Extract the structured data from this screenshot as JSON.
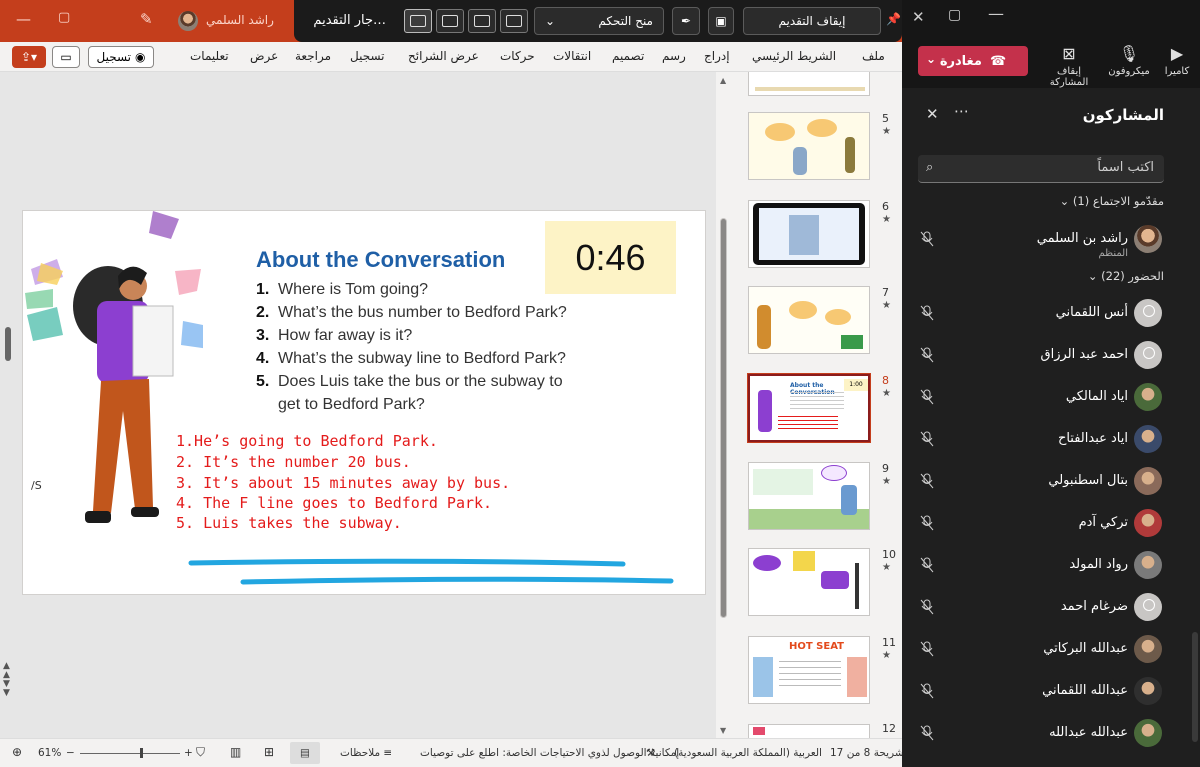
{
  "ppt": {
    "user_name": "راشد السلمي",
    "presenter": {
      "title": "…جار التقديم",
      "give_control": "منح التحكم",
      "stop_presenting": "إيقاف التقديم"
    },
    "ribbon_tabs": [
      "ملف",
      "الشريط الرئيسي",
      "إدراج",
      "رسم",
      "تصميم",
      "انتقالات",
      "حركات",
      "عرض الشرائح",
      "تسجيل",
      "مراجعة",
      "عرض",
      "تعليمات"
    ],
    "record_label": "تسجيل",
    "slide": {
      "title": "About the Conversation",
      "timer": "0:46",
      "questions": [
        {
          "n": "1.",
          "t": "Where is Tom going?"
        },
        {
          "n": "2.",
          "t": "What’s the bus number to Bedford Park?"
        },
        {
          "n": "3.",
          "t": "How far away is it?"
        },
        {
          "n": "4.",
          "t": "What’s the subway line to Bedford Park?"
        },
        {
          "n": "5.",
          "t": "Does Luis take the bus or the subway to"
        },
        {
          "n": "",
          "t": "get to Bedford Park?"
        }
      ],
      "answers": [
        "1.He’s going to Bedford Park.",
        "2. It’s the number 20 bus.",
        "3. It’s about 15 minutes away by bus.",
        "4. The F line goes to Bedford Park.",
        "5. Luis takes the subway."
      ]
    },
    "thumbnails": [
      {
        "num": "5"
      },
      {
        "num": "6"
      },
      {
        "num": "7"
      },
      {
        "num": "8",
        "timer": "1:00",
        "selected": true
      },
      {
        "num": "9"
      },
      {
        "num": "10"
      },
      {
        "num": "11",
        "text": "HOT SEAT"
      },
      {
        "num": "12"
      }
    ],
    "status": {
      "slide_pos": "شريحة 8 من 17",
      "language": "العربية (المملكة العربية السعودية)",
      "accessibility": "إمكانية الوصول لذوي الاحتياجات الخاصة: اطلع على توصيات",
      "notes": "ملاحظات",
      "zoom": "61%",
      "zoom_fraction": 0.6
    }
  },
  "teams": {
    "controls": {
      "camera": "كاميرا",
      "mic": "ميكروفون",
      "stop_share": "إيقاف المشاركة",
      "leave": "مغادرة"
    },
    "panel_title": "المشاركون",
    "search_placeholder": "اكتب اسماً",
    "organizers_header": "مقدّمو الاجتماع (1)",
    "organizer": {
      "name": "راشد بن السلمي",
      "role": "المنظم"
    },
    "attendees_header": "الحضور (22)",
    "attendees": [
      {
        "name": "أنس اللقماني",
        "avatar": "generic"
      },
      {
        "name": "احمد عبد الرزاق",
        "avatar": "generic"
      },
      {
        "name": "اياد المالكي",
        "avatar": "photo"
      },
      {
        "name": "اياد عبدالفتاح",
        "avatar": "photo"
      },
      {
        "name": "بتال اسطنبولي",
        "avatar": "photo"
      },
      {
        "name": "تركي آدم",
        "avatar": "photo"
      },
      {
        "name": "رواد المولد",
        "avatar": "photo"
      },
      {
        "name": "ضرغام احمد",
        "avatar": "generic"
      },
      {
        "name": "عبدالله البركاتي",
        "avatar": "photo"
      },
      {
        "name": "عبدالله اللقماني",
        "avatar": "photo"
      },
      {
        "name": "عبدالله عبدالله",
        "avatar": "photo"
      }
    ]
  }
}
